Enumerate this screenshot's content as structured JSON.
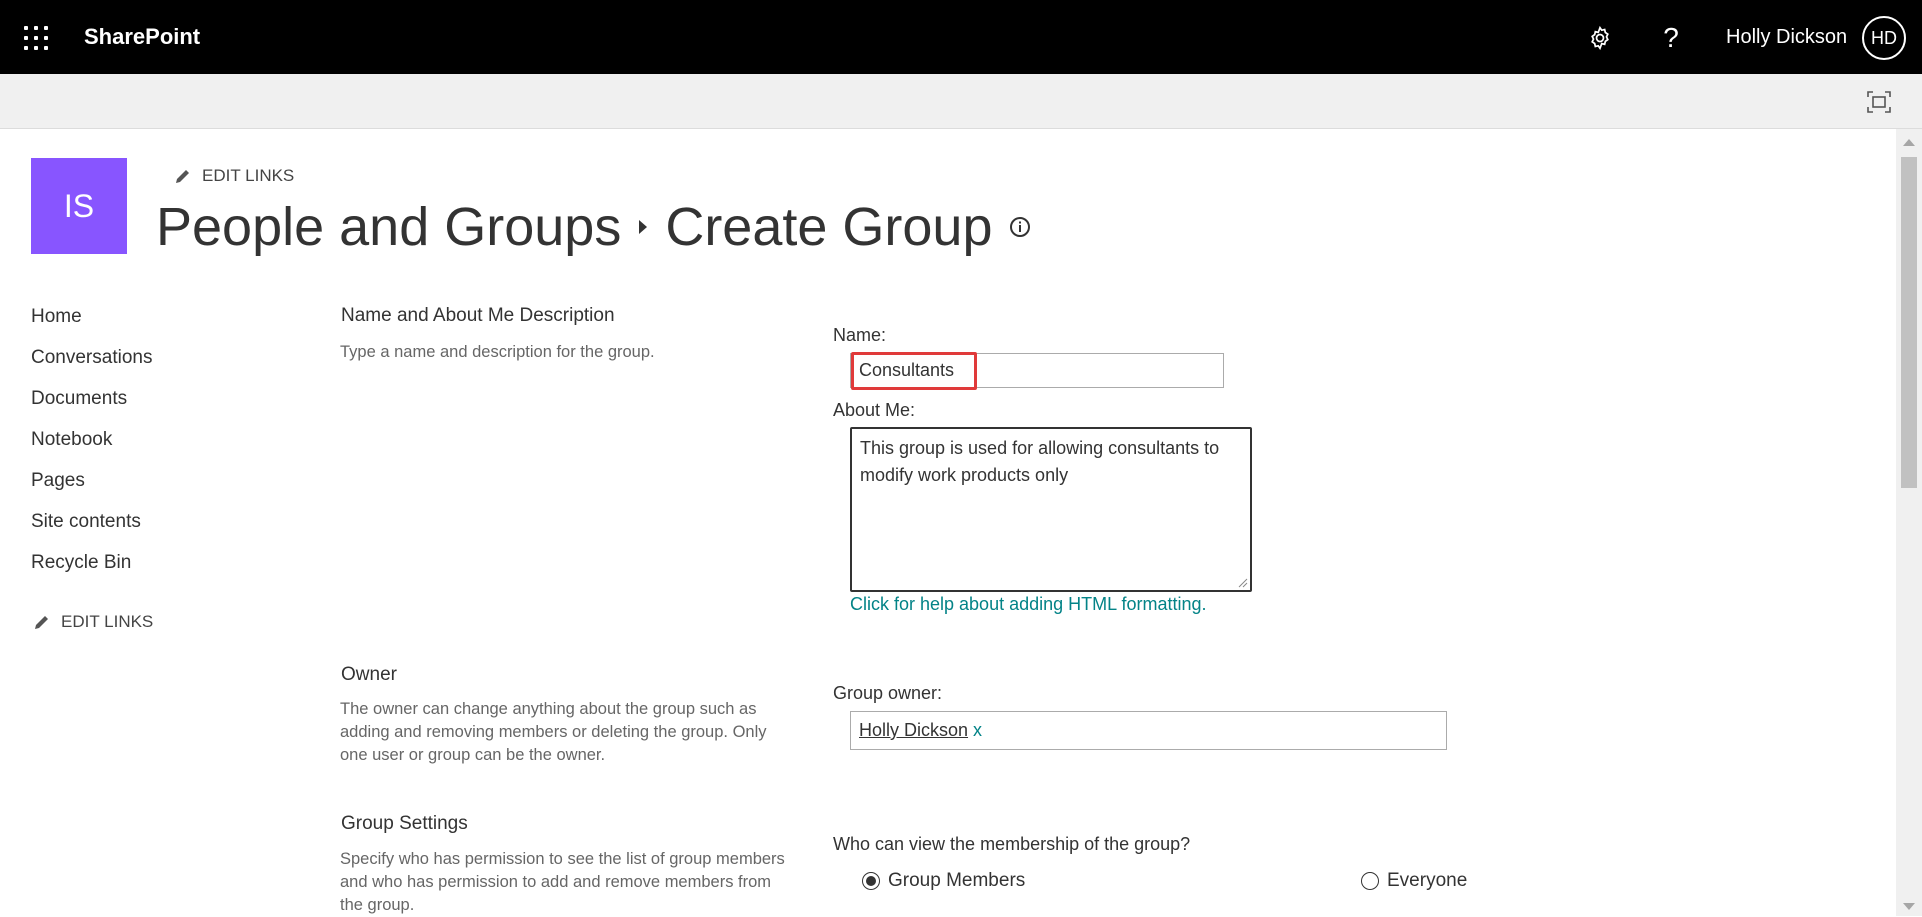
{
  "suitebar": {
    "app_name": "SharePoint",
    "user_name": "Holly Dickson",
    "user_initials": "HD",
    "help_glyph": "?",
    "icons": [
      "app-launcher-icon",
      "gear-icon",
      "help-icon"
    ]
  },
  "site": {
    "logo_text": "IS",
    "logo_color": "#8855ff",
    "edit_links_label": "EDIT LINKS"
  },
  "breadcrumb": {
    "parent": "People and Groups",
    "current": "Create Group"
  },
  "leftnav": {
    "items": [
      {
        "label": "Home"
      },
      {
        "label": "Conversations"
      },
      {
        "label": "Documents"
      },
      {
        "label": "Notebook"
      },
      {
        "label": "Pages"
      },
      {
        "label": "Site contents"
      },
      {
        "label": "Recycle Bin"
      }
    ],
    "edit_links_label": "EDIT LINKS"
  },
  "form": {
    "name_section": {
      "title": "Name and About Me Description",
      "description": "Type a name and description for the group.",
      "name_label": "Name:",
      "name_value": "Consultants",
      "about_label": "About Me:",
      "about_value": "This group is used for allowing consultants to modify work products only",
      "help_link": "Click for help about adding HTML formatting."
    },
    "owner_section": {
      "title": "Owner",
      "description": "The owner can change anything about the group such as adding and removing members or deleting the group. Only one user or group can be the owner.",
      "owner_label": "Group owner:",
      "owner_value": "Holly Dickson",
      "remove_glyph": "x"
    },
    "settings_section": {
      "title": "Group Settings",
      "description": "Specify who has permission to see the list of group members and who has permission to add and remove members from the group.",
      "view_label": "Who can view the membership of the group?",
      "options": [
        {
          "label": "Group Members",
          "selected": true
        },
        {
          "label": "Everyone",
          "selected": false
        }
      ]
    }
  },
  "colors": {
    "suitebar_bg": "#000000",
    "accent_link": "#038387",
    "highlight_box": "#e03a3a"
  }
}
